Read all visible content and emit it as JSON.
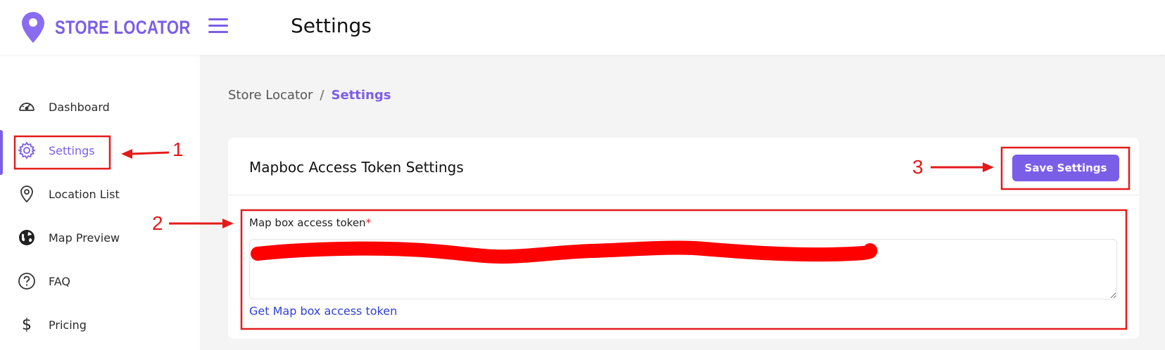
{
  "app": {
    "brand": "STORE LOCATOR",
    "page_title": "Settings",
    "accent_color": "#7b5ee8"
  },
  "sidebar": {
    "items": [
      {
        "label": "Dashboard",
        "icon": "speedometer-icon",
        "active": false
      },
      {
        "label": "Settings",
        "icon": "gear-icon",
        "active": true
      },
      {
        "label": "Location List",
        "icon": "map-pin-icon",
        "active": false
      },
      {
        "label": "Map Preview",
        "icon": "globe-icon",
        "active": false
      },
      {
        "label": "FAQ",
        "icon": "question-circle-icon",
        "active": false
      },
      {
        "label": "Pricing",
        "icon": "dollar-icon",
        "active": false
      }
    ]
  },
  "breadcrumb": {
    "parent": "Store Locator",
    "separator": "/",
    "current": "Settings"
  },
  "card": {
    "title": "Mapboc Access Token Settings",
    "save_label": "Save Settings",
    "field_label": "Map box access token",
    "required_mark": "*",
    "token_value": "",
    "link_label": "Get Map box access token"
  },
  "annotations": {
    "step1": "1",
    "step2": "2",
    "step3": "3",
    "color": "#e41b1b"
  }
}
